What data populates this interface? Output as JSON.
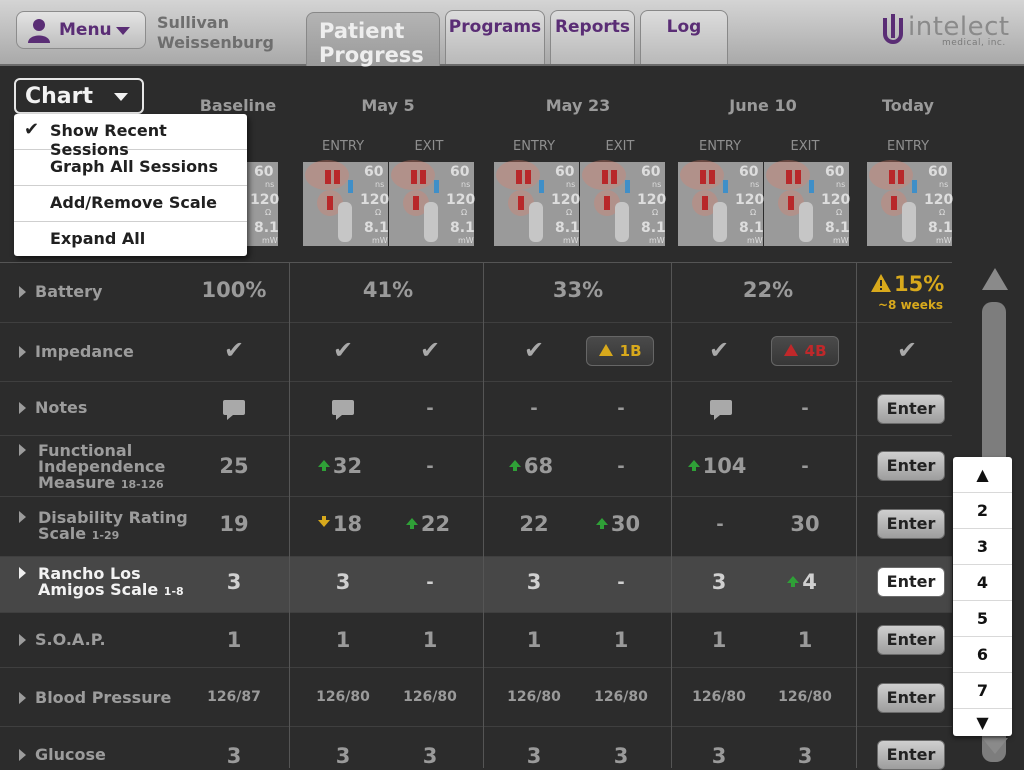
{
  "header": {
    "menu_label": "Menu",
    "patient_first": "Sullivan",
    "patient_last": "Weissenburg",
    "tabs": [
      {
        "label_line1": "Patient",
        "label_line2": "Progress"
      },
      {
        "label": "Programs"
      },
      {
        "label": "Reports"
      },
      {
        "label": "Log"
      }
    ],
    "logo_text": "intelect",
    "logo_sub": "medical, inc."
  },
  "chart_selector": {
    "label": "Chart"
  },
  "dropdown": {
    "items": [
      {
        "label": "Show Recent Sessions",
        "checked": true
      },
      {
        "label": "Graph All Sessions"
      },
      {
        "label": "Add/Remove Scale"
      },
      {
        "label": "Expand All"
      }
    ]
  },
  "columns": {
    "baseline": "Baseline",
    "may5": "May 5",
    "may23": "May 23",
    "june10": "June 10",
    "today": "Today",
    "entry": "ENTRY",
    "exit": "EXIT"
  },
  "meter": {
    "v1": "60",
    "u1": "ns",
    "v2": "120",
    "u2": "Ω",
    "v3": "8.1",
    "u3": "mW"
  },
  "rows": {
    "battery": {
      "label": "Battery",
      "baseline": "100%",
      "may5": "41%",
      "may23": "33%",
      "june10": "22%",
      "today": "15%",
      "today_sub": "~8 weeks"
    },
    "impedance": {
      "label": "Impedance",
      "may23_exit": "1B",
      "june10_exit": "4B"
    },
    "notes": {
      "label": "Notes",
      "dash": "-"
    },
    "fim": {
      "label1": "Functional",
      "label2": "Independence",
      "label3": "Measure",
      "range": "18-126",
      "baseline": "25",
      "may5_entry": "32",
      "may23_entry": "68",
      "june10_entry": "104"
    },
    "drs": {
      "label1": "Disability Rating",
      "label2": "Scale",
      "range": "1-29",
      "baseline": "19",
      "may5_entry": "18",
      "may5_exit": "22",
      "may23_entry": "22",
      "may23_exit": "30",
      "june10_exit": "30"
    },
    "rancho": {
      "label1": "Rancho Los",
      "label2": "Amigos Scale",
      "range": "1-8",
      "baseline": "3",
      "may5_entry": "3",
      "may23_entry": "3",
      "june10_entry": "3",
      "june10_exit": "4"
    },
    "soap": {
      "label": "S.O.A.P.",
      "value": "1"
    },
    "bp": {
      "label": "Blood Pressure",
      "baseline": "126/87",
      "value": "126/80"
    },
    "glucose": {
      "label": "Glucose",
      "value": "3"
    }
  },
  "enter_label": "Enter",
  "picker": {
    "up": "▲",
    "items": [
      "2",
      "3",
      "4",
      "5",
      "6",
      "7"
    ],
    "down": "▼"
  }
}
